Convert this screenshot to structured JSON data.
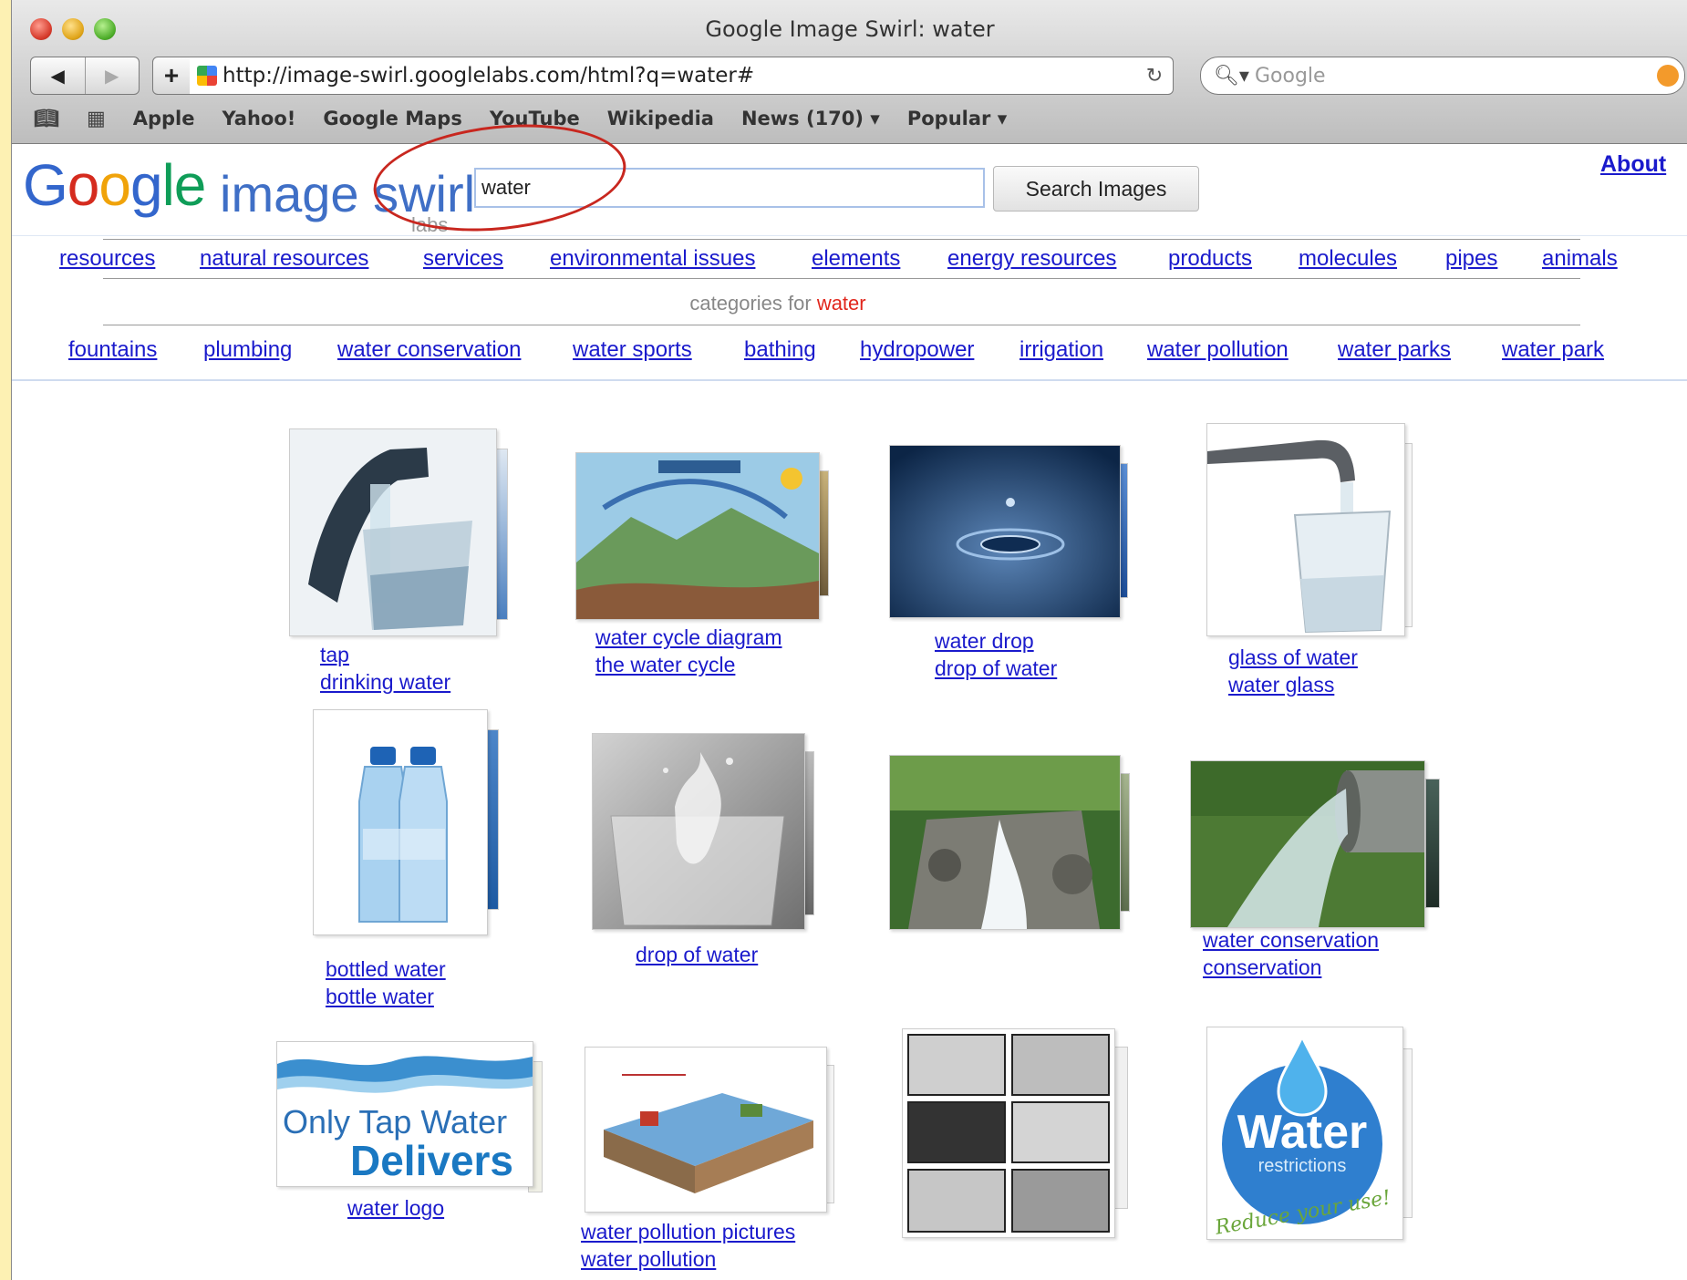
{
  "browser": {
    "window_title": "Google Image Swirl: water",
    "url": "http://image-swirl.googlelabs.com/html?q=water#",
    "search_placeholder": "Google",
    "nav_back": "◀",
    "nav_forward": "▶",
    "add": "+",
    "reload": "C",
    "bookmarks": [
      "Apple",
      "Yahoo!",
      "Google Maps",
      "YouTube",
      "Wikipedia",
      "News (170) ▾",
      "Popular ▾"
    ]
  },
  "page": {
    "logo_text": [
      "G",
      "o",
      "o",
      "g",
      "le"
    ],
    "logo_word": "image swirl",
    "labs": "labs",
    "query": "water",
    "search_button": "Search Images",
    "about": "About",
    "categories_label": "categories for",
    "categories_term": "water",
    "top_categories": [
      "resources",
      "natural resources",
      "services",
      "environmental issues",
      "elements",
      "energy resources",
      "products",
      "molecules",
      "pipes",
      "animals"
    ],
    "bottom_categories": [
      "fountains",
      "plumbing",
      "water conservation",
      "water sports",
      "bathing",
      "hydropower",
      "irrigation",
      "water pollution",
      "water parks",
      "water park"
    ]
  },
  "results": [
    {
      "captions": [
        "tap",
        "drinking water"
      ],
      "icon": "tap-glass-image"
    },
    {
      "captions": [
        "water cycle diagram",
        "the water cycle"
      ],
      "icon": "water-cycle-diagram-image"
    },
    {
      "captions": [
        "water drop",
        "drop of water"
      ],
      "icon": "water-drop-image"
    },
    {
      "captions": [
        "glass of water",
        "water glass"
      ],
      "icon": "glass-of-water-image"
    },
    {
      "captions": [
        "bottled water",
        "bottle water"
      ],
      "icon": "bottled-water-image"
    },
    {
      "captions": [
        "drop of water"
      ],
      "icon": "splash-glass-image"
    },
    {
      "captions": [],
      "icon": "waterfall-image"
    },
    {
      "captions": [
        "water conservation",
        "conservation"
      ],
      "icon": "pipe-outflow-image"
    },
    {
      "captions": [
        "water logo"
      ],
      "icon": "tap-water-logo-image",
      "image_text": [
        "Only Tap Water",
        "Delivers"
      ]
    },
    {
      "captions": [
        "water pollution pictures",
        "water pollution"
      ],
      "icon": "pollution-diagram-image"
    },
    {
      "captions": [],
      "icon": "comic-strip-image"
    },
    {
      "captions": [],
      "icon": "water-restrictions-logo-image",
      "image_text": [
        "Water",
        "restrictions",
        "Reduce your use!"
      ]
    }
  ]
}
